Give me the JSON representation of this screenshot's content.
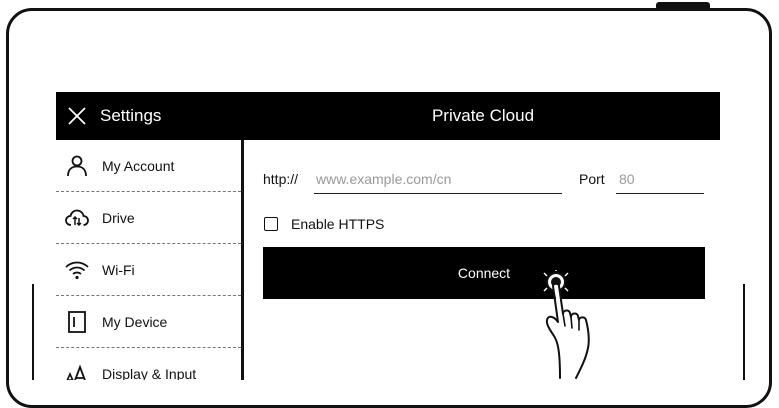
{
  "titlebar": {
    "settings_title": "Settings",
    "page_title": "Private Cloud",
    "close_icon": "close-icon"
  },
  "sidebar": {
    "items": [
      {
        "label": "My Account",
        "icon": "user-icon"
      },
      {
        "label": "Drive",
        "icon": "cloud-sync-icon"
      },
      {
        "label": "Wi-Fi",
        "icon": "wifi-icon"
      },
      {
        "label": "My Device",
        "icon": "device-icon"
      },
      {
        "label": "Display & Input",
        "icon": "font-size-icon"
      }
    ]
  },
  "content": {
    "url_prefix": "http://",
    "url_placeholder": "www.example.com/cn",
    "url_value": "",
    "port_label": "Port",
    "port_placeholder": "80",
    "port_value": "",
    "https_label": "Enable HTTPS",
    "https_checked": false,
    "connect_label": "Connect"
  },
  "colors": {
    "titlebar_bg": "#000000",
    "button_bg": "#000000",
    "text": "#111111"
  }
}
